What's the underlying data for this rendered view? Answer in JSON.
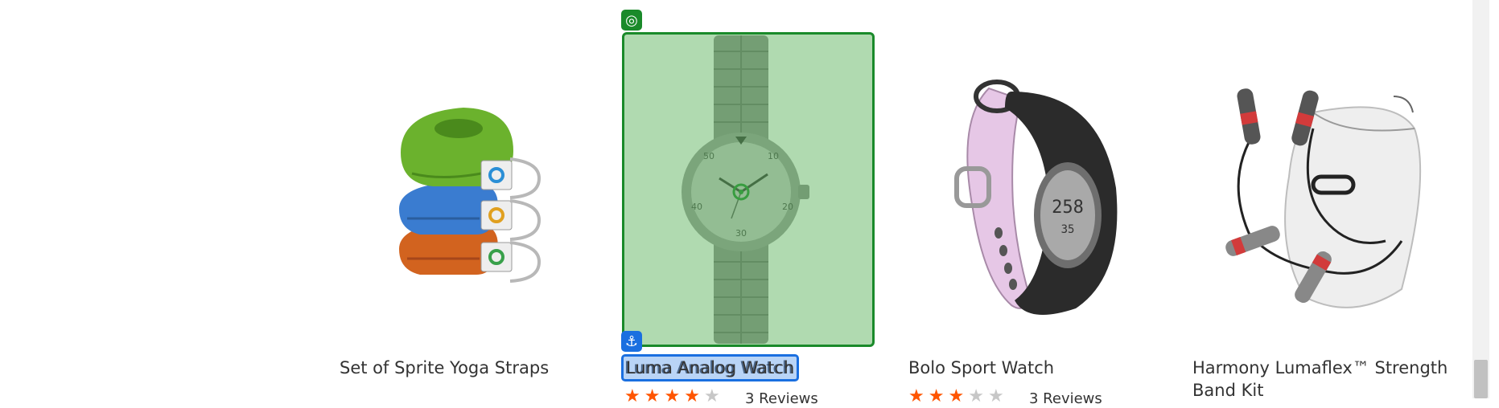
{
  "products": [
    {
      "name": "Set of Sprite Yoga Straps",
      "image": "yoga-straps-image",
      "rating": 0,
      "reviews": ""
    },
    {
      "name": "Luma Analog Watch",
      "image": "analog-watch-image",
      "rating": 4,
      "reviews": "3 Reviews"
    },
    {
      "name": "Bolo Sport Watch",
      "image": "sport-watch-image",
      "rating": 3,
      "reviews": "3 Reviews"
    },
    {
      "name": "Harmony Lumaflex™ Strength Band Kit",
      "image": "strength-band-kit-image",
      "rating": 0,
      "reviews": ""
    }
  ],
  "overlay": {
    "target_icon": "target-icon",
    "anchor_icon": "anchor-icon",
    "highlight_color": "#1a8a2a",
    "anchor_color": "#1a6fe0"
  },
  "colors": {
    "star_on": "#ff5501",
    "star_off": "#c7c7c7"
  }
}
